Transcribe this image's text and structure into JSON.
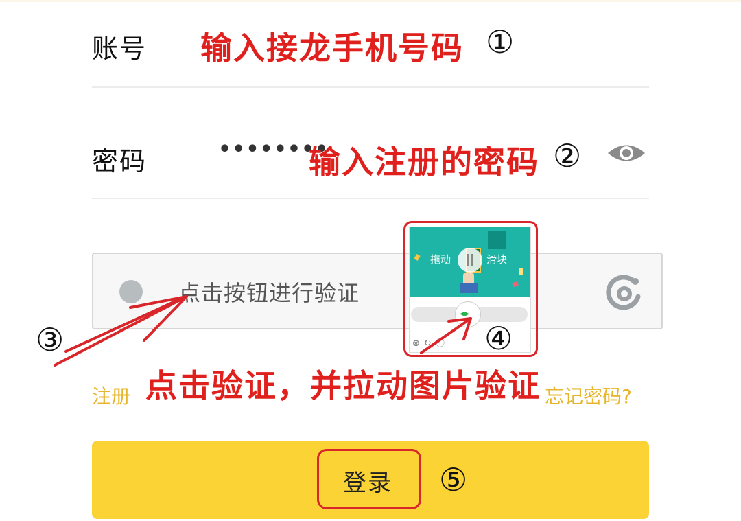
{
  "account": {
    "label": "账号",
    "annotation": "输入接龙手机号码",
    "step": "①"
  },
  "password": {
    "label": "密码",
    "value": "••••••••",
    "annotation": "输入注册的密码",
    "step": "②",
    "toggle_icon": "eye-icon"
  },
  "captcha": {
    "prompt": "点击按钮进行验证",
    "step": "③",
    "logo_icon": "captcha-logo-icon",
    "popup": {
      "left_text": "拖动",
      "right_text": "滑块",
      "step": "④",
      "slider_icon": "double-arrow-icon",
      "footer_icons": [
        "close-icon",
        "refresh-icon",
        "info-icon"
      ]
    }
  },
  "links": {
    "register": "注册",
    "forgot": "忘记密码?"
  },
  "captcha_annotation": "点击验证，并拉动图片验证",
  "login": {
    "label": "登录",
    "step": "⑤"
  },
  "colors": {
    "annotation_red": "#e0201d",
    "link_gold": "#e8b52a",
    "button_yellow": "#fbd335"
  }
}
